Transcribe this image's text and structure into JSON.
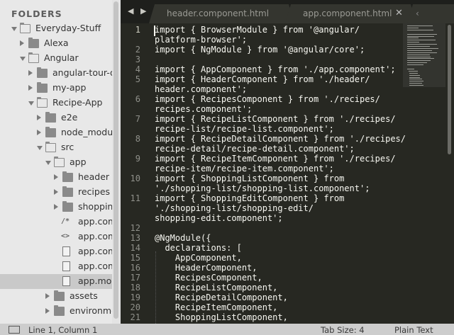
{
  "sidebar": {
    "title": "FOLDERS",
    "tree": [
      {
        "label": "Everyday-Stuff",
        "state": "open",
        "kind": "folder",
        "indent": 0
      },
      {
        "label": "Alexa",
        "state": "closed",
        "kind": "folder",
        "indent": 1
      },
      {
        "label": "Angular",
        "state": "open",
        "kind": "folder",
        "indent": 1
      },
      {
        "label": "angular-tour-of-heroes",
        "state": "closed",
        "kind": "folder",
        "indent": 2
      },
      {
        "label": "my-app",
        "state": "closed",
        "kind": "folder",
        "indent": 2
      },
      {
        "label": "Recipe-App",
        "state": "open",
        "kind": "folder",
        "indent": 2
      },
      {
        "label": "e2e",
        "state": "closed",
        "kind": "folder",
        "indent": 3
      },
      {
        "label": "node_modules",
        "state": "closed",
        "kind": "folder",
        "indent": 3
      },
      {
        "label": "src",
        "state": "open",
        "kind": "folder",
        "indent": 3
      },
      {
        "label": "app",
        "state": "open",
        "kind": "folder",
        "indent": 4
      },
      {
        "label": "header",
        "state": "closed",
        "kind": "folder",
        "indent": 5
      },
      {
        "label": "recipes",
        "state": "closed",
        "kind": "folder",
        "indent": 5
      },
      {
        "label": "shopping-list",
        "state": "closed",
        "kind": "folder",
        "indent": 5
      },
      {
        "label": "app.component.css",
        "kind": "css",
        "indent": 5,
        "icon": "/*"
      },
      {
        "label": "app.component.html",
        "kind": "html",
        "indent": 5,
        "icon": "<>"
      },
      {
        "label": "app.component.spec.ts",
        "kind": "file",
        "indent": 5
      },
      {
        "label": "app.component.ts",
        "kind": "file",
        "indent": 5
      },
      {
        "label": "app.module.ts",
        "kind": "file",
        "indent": 5,
        "selected": true
      },
      {
        "label": "assets",
        "state": "closed",
        "kind": "folder",
        "indent": 4
      },
      {
        "label": "environments",
        "state": "closed",
        "kind": "folder",
        "indent": 4
      }
    ]
  },
  "tabs": {
    "nav": "◀ ▶",
    "items": [
      {
        "label": "header.component.html",
        "close": "",
        "active": false
      },
      {
        "label": "app.component.html",
        "close": "✕",
        "active": false
      }
    ]
  },
  "editor": {
    "lines": [
      {
        "num": "1",
        "text": "import { BrowserModule } from '@angular/"
      },
      {
        "num": "",
        "text": "platform-browser';"
      },
      {
        "num": "2",
        "text": "import { NgModule } from '@angular/core';"
      },
      {
        "num": "3",
        "text": ""
      },
      {
        "num": "4",
        "text": "import { AppComponent } from './app.component';"
      },
      {
        "num": "5",
        "text": "import { HeaderComponent } from './header/"
      },
      {
        "num": "",
        "text": "header.component';"
      },
      {
        "num": "6",
        "text": "import { RecipesComponent } from './recipes/"
      },
      {
        "num": "",
        "text": "recipes.component';"
      },
      {
        "num": "7",
        "text": "import { RecipeListComponent } from './recipes/"
      },
      {
        "num": "",
        "text": "recipe-list/recipe-list.component';"
      },
      {
        "num": "8",
        "text": "import { RecipeDetailComponent } from './recipes/"
      },
      {
        "num": "",
        "text": "recipe-detail/recipe-detail.component';"
      },
      {
        "num": "9",
        "text": "import { RecipeItemComponent } from './recipes/"
      },
      {
        "num": "",
        "text": "recipe-item/recipe-item.component';"
      },
      {
        "num": "10",
        "text": "import { ShoppingListComponent } from"
      },
      {
        "num": "",
        "text": "'./shopping-list/shopping-list.component';"
      },
      {
        "num": "11",
        "text": "import { ShoppingEditComponent } from"
      },
      {
        "num": "",
        "text": "'./shopping-list/shopping-edit/"
      },
      {
        "num": "",
        "text": "shopping-edit.component';"
      },
      {
        "num": "12",
        "text": ""
      },
      {
        "num": "13",
        "text": "@NgModule({"
      },
      {
        "num": "14",
        "text": "  declarations: ["
      },
      {
        "num": "15",
        "text": "    AppComponent,"
      },
      {
        "num": "16",
        "text": "    HeaderComponent,"
      },
      {
        "num": "17",
        "text": "    RecipesComponent,"
      },
      {
        "num": "18",
        "text": "    RecipeListComponent,"
      },
      {
        "num": "19",
        "text": "    RecipeDetailComponent,"
      },
      {
        "num": "20",
        "text": "    RecipeItemComponent,"
      },
      {
        "num": "21",
        "text": "    ShoppingListComponent,"
      }
    ]
  },
  "status": {
    "position": "Line 1, Column 1",
    "tab_size": "Tab Size: 4",
    "syntax": "Plain Text"
  },
  "colors": {
    "editor_bg": "#272822",
    "sidebar_bg": "#e8e8e8",
    "tabbar_bg": "#1e1f1c",
    "text": "#f8f8f2"
  }
}
